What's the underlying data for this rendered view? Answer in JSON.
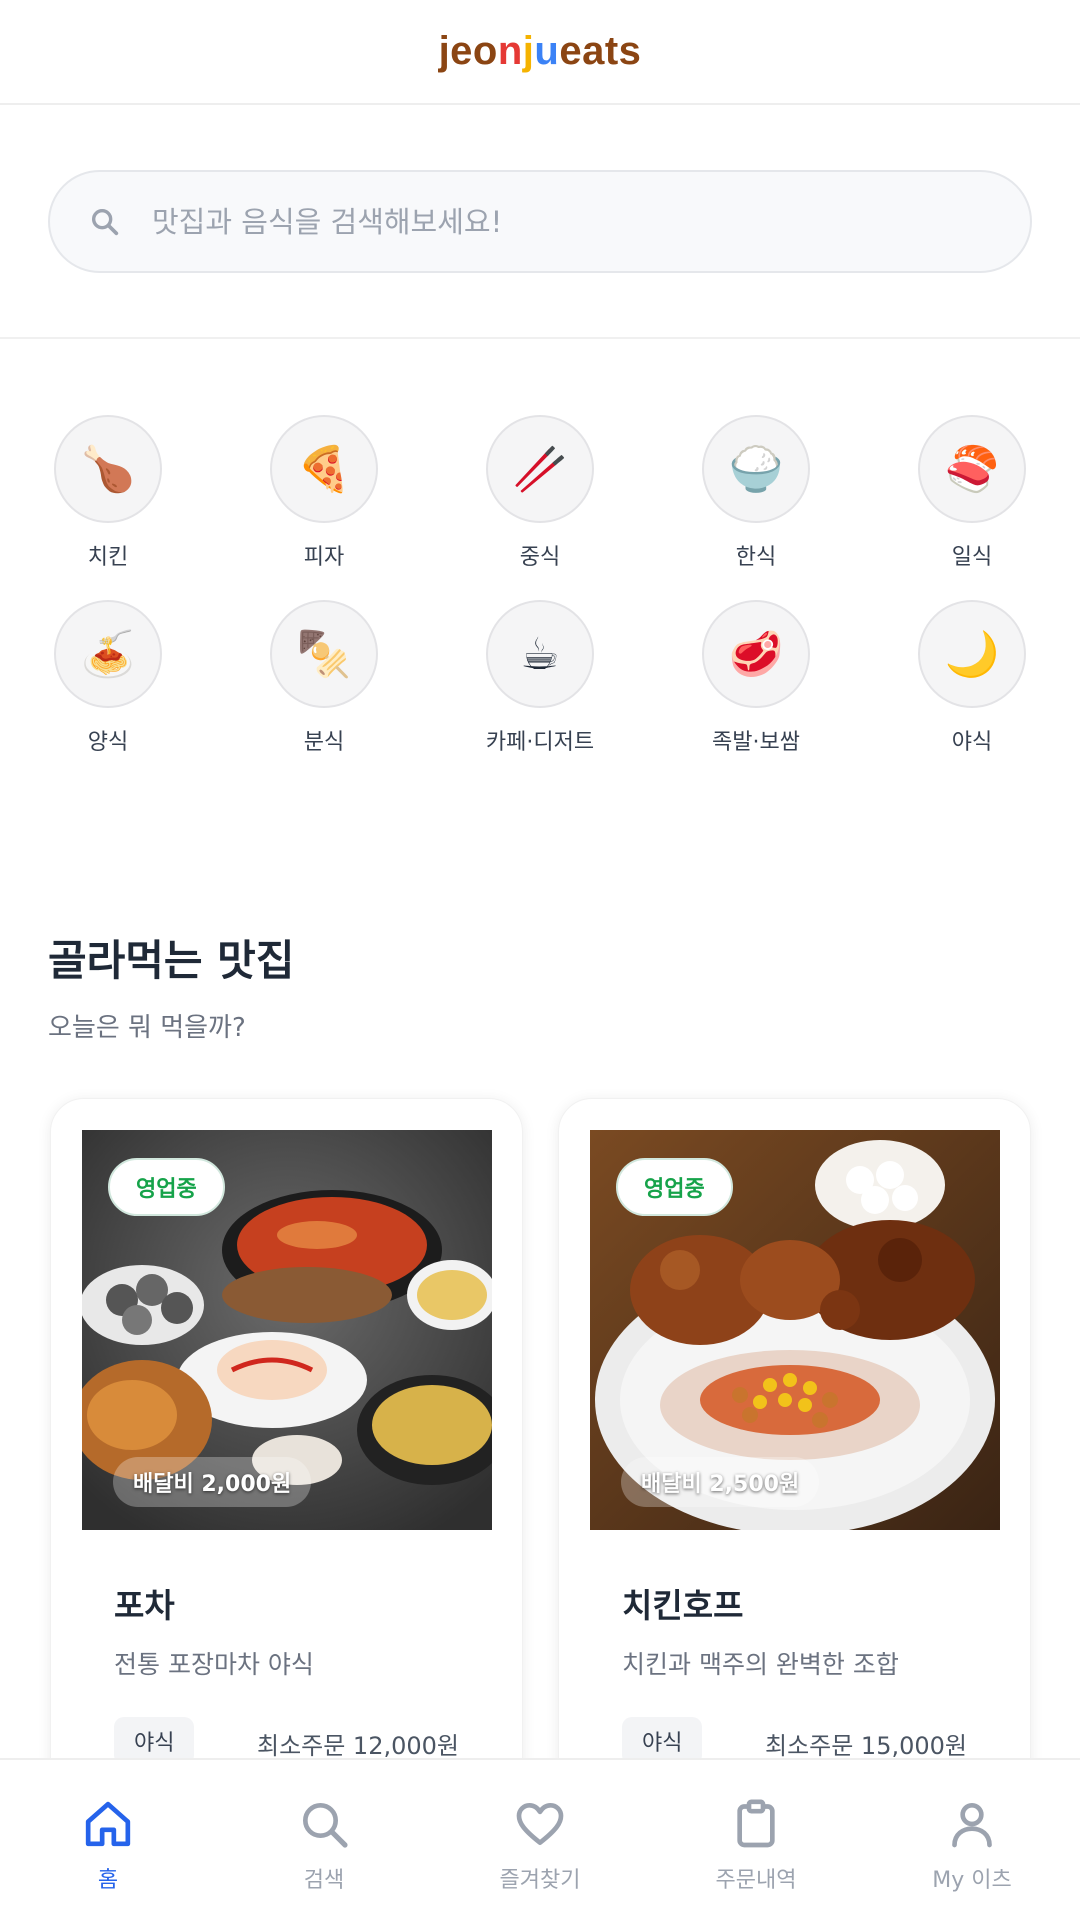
{
  "header": {
    "logo_parts": [
      {
        "text": "jeo",
        "color": "#8B4513"
      },
      {
        "text": "n",
        "color": "#E53935"
      },
      {
        "text": "j",
        "color": "#F5B301"
      },
      {
        "text": "u",
        "color": "#3B82F6"
      },
      {
        "text": "eats",
        "color": "#8B4513"
      }
    ]
  },
  "search": {
    "placeholder": "맛집과 음식을 검색해보세요!",
    "value": ""
  },
  "categories": [
    {
      "label": "치킨",
      "icon": "🍗",
      "icon_name": "chicken-icon"
    },
    {
      "label": "피자",
      "icon": "🍕",
      "icon_name": "pizza-icon"
    },
    {
      "label": "중식",
      "icon": "🥢",
      "icon_name": "chopsticks-icon"
    },
    {
      "label": "한식",
      "icon": "🍚",
      "icon_name": "rice-icon"
    },
    {
      "label": "일식",
      "icon": "🍣",
      "icon_name": "sushi-icon"
    },
    {
      "label": "양식",
      "icon": "🍝",
      "icon_name": "pasta-icon"
    },
    {
      "label": "분식",
      "icon": "🍢",
      "icon_name": "oden-icon"
    },
    {
      "label": "카페·디저트",
      "icon": "☕",
      "icon_name": "coffee-icon"
    },
    {
      "label": "족발·보쌈",
      "icon": "🥩",
      "icon_name": "meat-icon"
    },
    {
      "label": "야식",
      "icon": "🌙",
      "icon_name": "moon-icon"
    }
  ],
  "section": {
    "title": "골라먹는 맛집",
    "subtitle": "오늘은 뭐 먹을까?"
  },
  "restaurants": [
    {
      "name": "포차",
      "description": "전통 포장마차 야식",
      "status": "영업중",
      "delivery_fee": "배달비 2,000원",
      "tag": "야식",
      "min_order": "최소주문 12,000원"
    },
    {
      "name": "치킨호프",
      "description": "치킨과 맥주의 완벽한 조합",
      "status": "영업중",
      "delivery_fee": "배달비 2,500원",
      "tag": "야식",
      "min_order": "최소주문 15,000원"
    }
  ],
  "nav": [
    {
      "label": "홈",
      "icon_name": "home-icon",
      "active": true
    },
    {
      "label": "검색",
      "icon_name": "search-icon",
      "active": false
    },
    {
      "label": "즐겨찾기",
      "icon_name": "heart-icon",
      "active": false
    },
    {
      "label": "주문내역",
      "icon_name": "clipboard-icon",
      "active": false
    },
    {
      "label": "My 이츠",
      "icon_name": "user-icon",
      "active": false
    }
  ],
  "colors": {
    "accent": "#2563eb",
    "open_green": "#16a34a",
    "nav_inactive": "#9ca3af"
  }
}
